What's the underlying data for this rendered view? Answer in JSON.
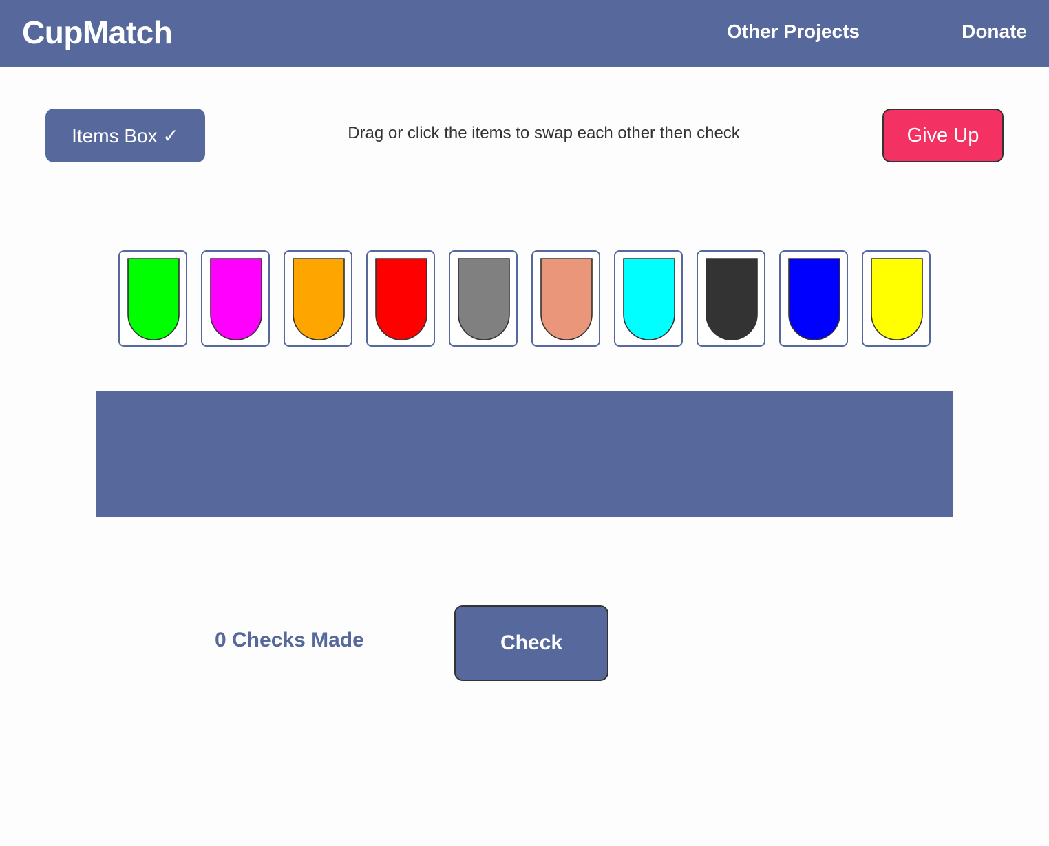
{
  "header": {
    "brand": "CupMatch",
    "nav": {
      "other_projects": "Other Projects",
      "donate": "Donate"
    }
  },
  "toolbar": {
    "items_box_label": "Items Box ✓",
    "instruction": "Drag or click the items to swap each other then check",
    "give_up_label": "Give Up"
  },
  "cups": [
    {
      "name": "green",
      "color": "#00ff00"
    },
    {
      "name": "magenta",
      "color": "#ff00ff"
    },
    {
      "name": "orange",
      "color": "#ffa500"
    },
    {
      "name": "red",
      "color": "#ff0000"
    },
    {
      "name": "gray",
      "color": "#808080"
    },
    {
      "name": "salmon",
      "color": "#e9967a"
    },
    {
      "name": "cyan",
      "color": "#00ffff"
    },
    {
      "name": "dark-gray",
      "color": "#333333"
    },
    {
      "name": "blue",
      "color": "#0000ff"
    },
    {
      "name": "yellow",
      "color": "#ffff00"
    }
  ],
  "footer": {
    "checks_made": "0 Checks Made",
    "check_label": "Check"
  },
  "colors": {
    "primary": "#56689c",
    "danger": "#f33162"
  }
}
